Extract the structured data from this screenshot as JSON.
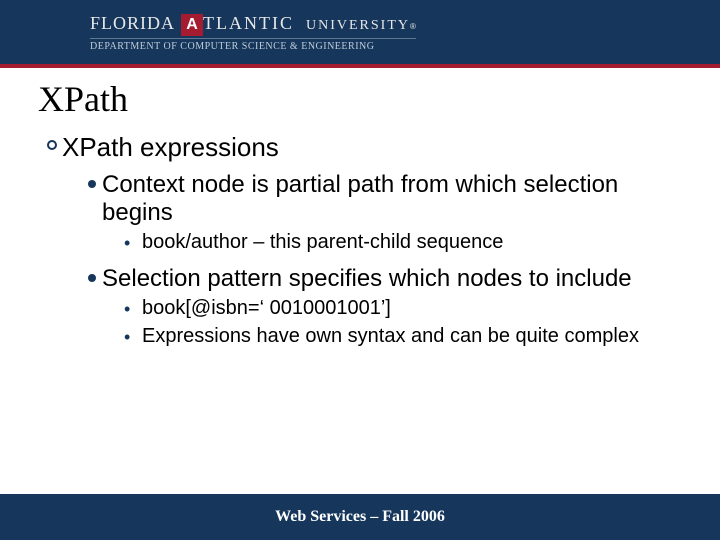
{
  "header": {
    "university_part1": "FLORIDA",
    "university_a": "A",
    "university_part2": "TLANTIC",
    "university_word": "UNIVERSITY",
    "registered": "®",
    "department": "DEPARTMENT OF COMPUTER SCIENCE & ENGINEERING"
  },
  "title": "XPath",
  "body": {
    "h1": "XPath expressions",
    "b1": {
      "text": "Context node is partial path from which selection begins",
      "sub1": "book/author – this parent-child sequence"
    },
    "b2": {
      "text": "Selection pattern specifies which nodes to include",
      "sub1": "book[@isbn=‘ 0010001001’]",
      "sub2": "Expressions have own syntax and can be quite complex"
    }
  },
  "footer": "Web Services – Fall 2006"
}
